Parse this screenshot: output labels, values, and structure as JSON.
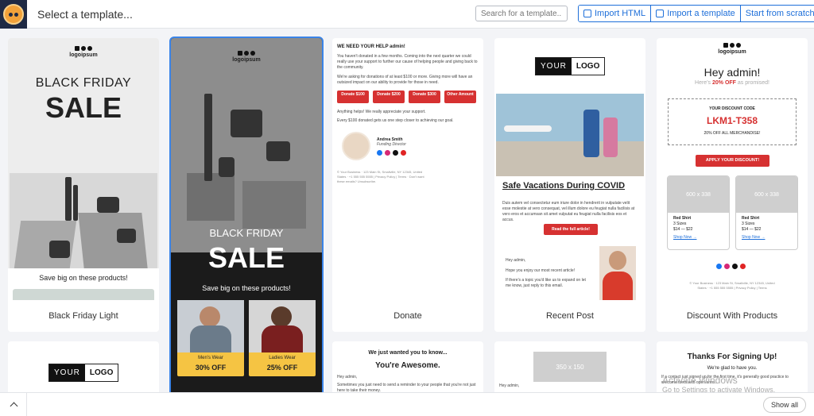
{
  "header": {
    "title": "Select a template...",
    "search_placeholder": "Search for a template...",
    "import_html": "Import HTML",
    "import_template": "Import a template",
    "start_scratch": "Start from scratch"
  },
  "cards": [
    {
      "label": "Black Friday Light",
      "logo": "logoipsum",
      "heading": "BLACK FRIDAY",
      "sale": "SALE",
      "caption": "Save big on these products!"
    },
    {
      "label": "",
      "logo": "logoipsum",
      "heading": "BLACK FRIDAY",
      "sale": "SALE",
      "caption": "Save big on these products!",
      "tiles": [
        {
          "category": "Men's Wear",
          "offer": "30% OFF"
        },
        {
          "category": "Ladies Wear",
          "offer": "25% OFF"
        }
      ]
    },
    {
      "label": "Donate",
      "heading": "WE NEED YOUR HELP admin!",
      "para1": "You haven't donated in a few months. Coming into the next quarter we could really use your support to further our cause of helping people and giving back to the community.",
      "para2": "We're asking for donations of at least $100 or more. Giving more will have an outsized impact on our ability to provide for those in need.",
      "buttons": [
        "Donate $100",
        "Donate $200",
        "Donate $300",
        "Other Amount"
      ],
      "para3": "Anything helps! We really appreciate your support.",
      "para4": "Every $100 donated gets us one step closer to achieving our goal.",
      "sig_name": "Andrea Smith",
      "sig_title": "Funding Director",
      "footer": "© Your Business · 123 Main St, Smallville, NY 12345, United States · +1 555 555 5555 | Privacy Policy | Terms · Don't want these emails? Unsubscribe."
    },
    {
      "label": "Recent Post",
      "logo_left": "YOUR",
      "logo_right": "LOGO",
      "post_title": "Safe Vacations During COVID",
      "post_text": "Duis autem vel consectetur eum iriure dolor in hendrerit in vulputate velit esse molestie at vero consequat, vel illum dolore eu feugiat nulla facilisis at vero eros et accumsan sit amet vulputat eu feugiat nulla facilisis eos et accus.",
      "cta": "Read the full article!",
      "hey": "Hey admin,",
      "hope": "Hope you enjoy our most recent article!",
      "reply": "If there's a topic you'd like us to expand on let me know, just reply to this email."
    },
    {
      "label": "Discount With Products",
      "logo": "logoipsum",
      "greeting": "Hey admin!",
      "sub_a": "Here's",
      "sub_b": "20% OFF",
      "sub_c": "as promised!",
      "code_label": "YOUR DISCOUNT CODE",
      "code": "LKM1-T358",
      "code_note": "20% OFF ALL MERCHANDISE!",
      "cta": "APPLY YOUR DISCOUNT!",
      "products": [
        {
          "ph": "600 x 338",
          "name": "Red Shirt",
          "sizes": "3 Sizes",
          "price": "$14 — $22",
          "link": "Shop Now →"
        },
        {
          "ph": "600 x 338",
          "name": "Red Shirt",
          "sizes": "3 Sizes",
          "price": "$14 — $22",
          "link": "Shop Now →"
        }
      ],
      "footer": "© Your Business · 123 Main St, Smallville, NY 12345, United States · +1 555 555 5555 | Privacy Policy | Terms"
    }
  ],
  "row2": [
    {
      "logo_left": "YOUR",
      "logo_right": "LOGO"
    },
    {},
    {
      "intro": "We just wanted you to know...",
      "heading": "You're Awesome.",
      "hey": "Hey admin,",
      "text": "Sometimes you just need to send a reminder to your people that you're not just here to take their money."
    },
    {
      "ph": "350 x 150",
      "hey": "Hey admin,"
    },
    {
      "heading": "Thanks For Signing Up!",
      "sub": "We're glad to have you.",
      "text": "If a contact just signed up for the first time, it's generally good practice to welcome them with open arms."
    }
  ],
  "footer": {
    "show_all": "Show all"
  },
  "watermark": {
    "line1": "Activate Windows",
    "line2": "Go to Settings to activate Windows."
  },
  "colors": {
    "accent": "#1e6fd9",
    "red": "#d63131",
    "dark": "#1f2a44",
    "gold": "#f5c443"
  }
}
